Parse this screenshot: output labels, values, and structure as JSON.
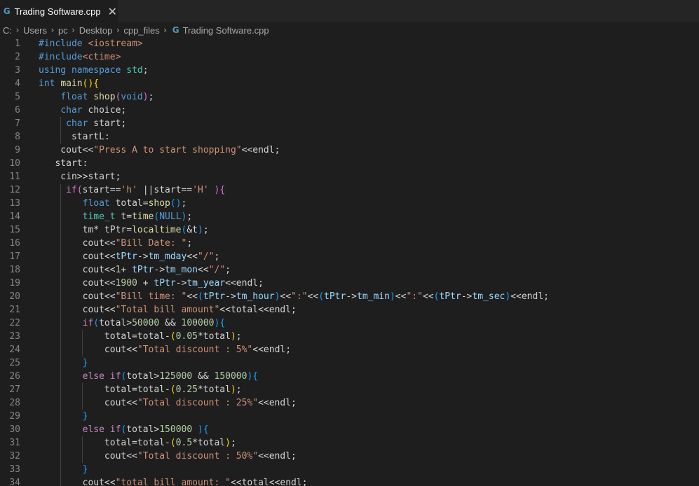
{
  "tab": {
    "icon": "cpp-file-icon",
    "title": "Trading Software.cpp"
  },
  "breadcrumb": {
    "items": [
      "C:",
      "Users",
      "pc",
      "Desktop",
      "cpp_files"
    ],
    "file": "Trading Software.cpp"
  },
  "colors": {
    "background": "#1e1e1e",
    "keyword": "#569cd6",
    "control": "#c586c0",
    "function": "#dcdcaa",
    "string": "#ce9178",
    "number": "#b5cea8",
    "type": "#4ec9b0",
    "variable": "#9cdcfe",
    "bracket1": "#ffd700",
    "bracket2": "#da70d6",
    "bracket3": "#179fff"
  },
  "code": [
    {
      "n": "1",
      "t": [
        [
          "kw",
          "#include "
        ],
        [
          "str",
          "<iostream>"
        ]
      ]
    },
    {
      "n": "2",
      "t": [
        [
          "kw",
          "#include"
        ],
        [
          "str",
          "<ctime>"
        ]
      ]
    },
    {
      "n": "3",
      "t": [
        [
          "kw",
          "using"
        ],
        [
          "pun",
          " "
        ],
        [
          "kw",
          "namespace"
        ],
        [
          "pun",
          " "
        ],
        [
          "type",
          "std"
        ],
        [
          "pun",
          ";"
        ]
      ]
    },
    {
      "n": "4",
      "t": [
        [
          "kw",
          "int"
        ],
        [
          "pun",
          " "
        ],
        [
          "fn",
          "main"
        ],
        [
          "br1",
          "()"
        ],
        [
          "br1",
          "{"
        ]
      ]
    },
    {
      "n": "5",
      "t": [
        [
          "pun",
          "    "
        ],
        [
          "kw",
          "float"
        ],
        [
          "pun",
          " "
        ],
        [
          "fn",
          "shop"
        ],
        [
          "br2",
          "("
        ],
        [
          "kw",
          "void"
        ],
        [
          "br2",
          ")"
        ],
        [
          "pun",
          ";"
        ]
      ]
    },
    {
      "n": "6",
      "t": [
        [
          "pun",
          "    "
        ],
        [
          "kw",
          "char"
        ],
        [
          "pun",
          " choice;"
        ]
      ]
    },
    {
      "n": "7",
      "t": [
        [
          "pun",
          "     "
        ],
        [
          "kw",
          "char"
        ],
        [
          "pun",
          " start;"
        ]
      ]
    },
    {
      "n": "8",
      "t": [
        [
          "pun",
          "      startL:"
        ]
      ]
    },
    {
      "n": "9",
      "t": [
        [
          "pun",
          "    cout<<"
        ],
        [
          "str",
          "\"Press A to start shopping\""
        ],
        [
          "pun",
          "<<endl;"
        ]
      ]
    },
    {
      "n": "10",
      "t": [
        [
          "pun",
          "   start:"
        ]
      ]
    },
    {
      "n": "11",
      "t": [
        [
          "pun",
          "    cin>>start;"
        ]
      ]
    },
    {
      "n": "12",
      "t": [
        [
          "pun",
          "     "
        ],
        [
          "ctrl",
          "if"
        ],
        [
          "br2",
          "("
        ],
        [
          "pun",
          "start=="
        ],
        [
          "str",
          "'h'"
        ],
        [
          "pun",
          " ||start=="
        ],
        [
          "str",
          "'H'"
        ],
        [
          "pun",
          " "
        ],
        [
          "br2",
          ")"
        ],
        [
          "br2",
          "{"
        ]
      ]
    },
    {
      "n": "13",
      "t": [
        [
          "pun",
          "        "
        ],
        [
          "kw",
          "float"
        ],
        [
          "pun",
          " total="
        ],
        [
          "fn",
          "shop"
        ],
        [
          "br3",
          "()"
        ],
        [
          "pun",
          ";"
        ]
      ]
    },
    {
      "n": "14",
      "t": [
        [
          "pun",
          "        "
        ],
        [
          "type",
          "time_t"
        ],
        [
          "pun",
          " t="
        ],
        [
          "fn",
          "time"
        ],
        [
          "br3",
          "("
        ],
        [
          "kw",
          "NULL"
        ],
        [
          "br3",
          ")"
        ],
        [
          "pun",
          ";"
        ]
      ]
    },
    {
      "n": "15",
      "t": [
        [
          "pun",
          "        tm* tPtr="
        ],
        [
          "fn",
          "localtime"
        ],
        [
          "br3",
          "("
        ],
        [
          "pun",
          "&t"
        ],
        [
          "br3",
          ")"
        ],
        [
          "pun",
          ";"
        ]
      ]
    },
    {
      "n": "16",
      "t": [
        [
          "pun",
          "        cout<<"
        ],
        [
          "str",
          "\"Bill Date: \""
        ],
        [
          "pun",
          ";"
        ]
      ]
    },
    {
      "n": "17",
      "t": [
        [
          "pun",
          "        cout<<"
        ],
        [
          "var",
          "tPtr"
        ],
        [
          "pun",
          "->"
        ],
        [
          "var",
          "tm_mday"
        ],
        [
          "pun",
          "<<"
        ],
        [
          "str",
          "\"/\""
        ],
        [
          "pun",
          ";"
        ]
      ]
    },
    {
      "n": "18",
      "t": [
        [
          "pun",
          "        cout<<"
        ],
        [
          "num",
          "1"
        ],
        [
          "pun",
          "+ "
        ],
        [
          "var",
          "tPtr"
        ],
        [
          "pun",
          "->"
        ],
        [
          "var",
          "tm_mon"
        ],
        [
          "pun",
          "<<"
        ],
        [
          "str",
          "\"/\""
        ],
        [
          "pun",
          ";"
        ]
      ]
    },
    {
      "n": "19",
      "t": [
        [
          "pun",
          "        cout<<"
        ],
        [
          "num",
          "1900"
        ],
        [
          "pun",
          " + "
        ],
        [
          "var",
          "tPtr"
        ],
        [
          "pun",
          "->"
        ],
        [
          "var",
          "tm_year"
        ],
        [
          "pun",
          "<<endl;"
        ]
      ]
    },
    {
      "n": "20",
      "t": [
        [
          "pun",
          "        cout<<"
        ],
        [
          "str",
          "\"Bill time: \""
        ],
        [
          "pun",
          "<<"
        ],
        [
          "br3",
          "("
        ],
        [
          "var",
          "tPtr"
        ],
        [
          "pun",
          "->"
        ],
        [
          "var",
          "tm_hour"
        ],
        [
          "br3",
          ")"
        ],
        [
          "pun",
          "<<"
        ],
        [
          "str",
          "\":\""
        ],
        [
          "pun",
          "<<"
        ],
        [
          "br3",
          "("
        ],
        [
          "var",
          "tPtr"
        ],
        [
          "pun",
          "->"
        ],
        [
          "var",
          "tm_min"
        ],
        [
          "br3",
          ")"
        ],
        [
          "pun",
          "<<"
        ],
        [
          "str",
          "\":\""
        ],
        [
          "pun",
          "<<"
        ],
        [
          "br3",
          "("
        ],
        [
          "var",
          "tPtr"
        ],
        [
          "pun",
          "->"
        ],
        [
          "var",
          "tm_sec"
        ],
        [
          "br3",
          ")"
        ],
        [
          "pun",
          "<<endl;"
        ]
      ]
    },
    {
      "n": "21",
      "t": [
        [
          "pun",
          "        cout<<"
        ],
        [
          "str",
          "\"Total bill amount\""
        ],
        [
          "pun",
          "<<total<<endl;"
        ]
      ]
    },
    {
      "n": "22",
      "t": [
        [
          "pun",
          "        "
        ],
        [
          "ctrl",
          "if"
        ],
        [
          "br3",
          "("
        ],
        [
          "pun",
          "total>"
        ],
        [
          "num",
          "50000"
        ],
        [
          "pun",
          " && "
        ],
        [
          "num",
          "100000"
        ],
        [
          "br3",
          ")"
        ],
        [
          "br3",
          "{"
        ]
      ]
    },
    {
      "n": "23",
      "t": [
        [
          "pun",
          "            total=total-"
        ],
        [
          "br1",
          "("
        ],
        [
          "num",
          "0.05"
        ],
        [
          "pun",
          "*total"
        ],
        [
          "br1",
          ")"
        ],
        [
          "pun",
          ";"
        ]
      ]
    },
    {
      "n": "24",
      "t": [
        [
          "pun",
          "            cout<<"
        ],
        [
          "str",
          "\"Total discount : 5%\""
        ],
        [
          "pun",
          "<<endl;"
        ]
      ]
    },
    {
      "n": "25",
      "t": [
        [
          "pun",
          "        "
        ],
        [
          "br3",
          "}"
        ]
      ]
    },
    {
      "n": "26",
      "t": [
        [
          "pun",
          "        "
        ],
        [
          "ctrl",
          "else"
        ],
        [
          "pun",
          " "
        ],
        [
          "ctrl",
          "if"
        ],
        [
          "br3",
          "("
        ],
        [
          "pun",
          "total>"
        ],
        [
          "num",
          "125000"
        ],
        [
          "pun",
          " && "
        ],
        [
          "num",
          "150000"
        ],
        [
          "br3",
          ")"
        ],
        [
          "br3",
          "{"
        ]
      ]
    },
    {
      "n": "27",
      "t": [
        [
          "pun",
          "            total=total-"
        ],
        [
          "br1",
          "("
        ],
        [
          "num",
          "0.25"
        ],
        [
          "pun",
          "*total"
        ],
        [
          "br1",
          ")"
        ],
        [
          "pun",
          ";"
        ]
      ]
    },
    {
      "n": "28",
      "t": [
        [
          "pun",
          "            cout<<"
        ],
        [
          "str",
          "\"Total discount : 25%\""
        ],
        [
          "pun",
          "<<endl;"
        ]
      ]
    },
    {
      "n": "29",
      "t": [
        [
          "pun",
          "        "
        ],
        [
          "br3",
          "}"
        ]
      ]
    },
    {
      "n": "30",
      "t": [
        [
          "pun",
          "        "
        ],
        [
          "ctrl",
          "else"
        ],
        [
          "pun",
          " "
        ],
        [
          "ctrl",
          "if"
        ],
        [
          "br3",
          "("
        ],
        [
          "pun",
          "total>"
        ],
        [
          "num",
          "150000"
        ],
        [
          "pun",
          " "
        ],
        [
          "br3",
          ")"
        ],
        [
          "br3",
          "{"
        ]
      ]
    },
    {
      "n": "31",
      "t": [
        [
          "pun",
          "            total=total-"
        ],
        [
          "br1",
          "("
        ],
        [
          "num",
          "0.5"
        ],
        [
          "pun",
          "*total"
        ],
        [
          "br1",
          ")"
        ],
        [
          "pun",
          ";"
        ]
      ]
    },
    {
      "n": "32",
      "t": [
        [
          "pun",
          "            cout<<"
        ],
        [
          "str",
          "\"Total discount : 50%\""
        ],
        [
          "pun",
          "<<endl;"
        ]
      ]
    },
    {
      "n": "33",
      "t": [
        [
          "pun",
          "        "
        ],
        [
          "br3",
          "}"
        ]
      ]
    },
    {
      "n": "34",
      "t": [
        [
          "pun",
          "        cout<<"
        ],
        [
          "str",
          "\"total bill amount: \""
        ],
        [
          "pun",
          "<<total<<endl;"
        ]
      ]
    }
  ]
}
